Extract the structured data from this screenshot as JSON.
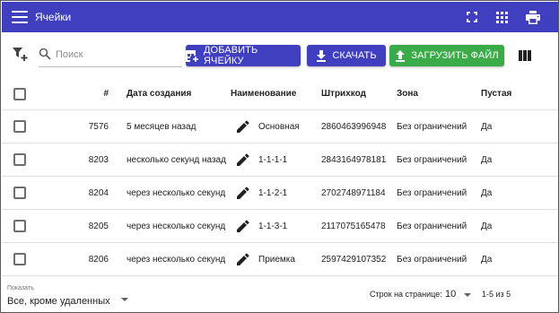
{
  "appbar": {
    "title": "Ячейки",
    "bg_color": "#3f3fbf",
    "icons": [
      "menu-icon",
      "fullscreen-icon",
      "apps-grid-icon",
      "print-icon"
    ]
  },
  "toolbar": {
    "search_placeholder": "Поиск",
    "add_label": "ДОБАВИТЬ ЯЧЕЙКУ",
    "download_label": "СКАЧАТЬ",
    "upload_label": "ЗАГРУЗИТЬ ФАЙЛ",
    "primary_color": "#3f3fbf",
    "upload_color": "#3aab48"
  },
  "table": {
    "headers": {
      "num": "#",
      "date": "Дата создания",
      "name": "Наименование",
      "barcode": "Штрихкод",
      "zone": "Зона",
      "empty": "Пустая"
    },
    "rows": [
      {
        "num": "7576",
        "date": "5 месяцев назад",
        "name": "Основная",
        "barcode": "2860463996948",
        "zone": "Без ограничений",
        "empty": "Да"
      },
      {
        "num": "8203",
        "date": "несколько секунд назад",
        "name": "1-1-1-1",
        "barcode": "2843164978181",
        "zone": "Без ограничений",
        "empty": "Да"
      },
      {
        "num": "8204",
        "date": "через несколько секунд",
        "name": "1-1-2-1",
        "barcode": "2702748971184",
        "zone": "Без ограничений",
        "empty": "Да"
      },
      {
        "num": "8205",
        "date": "через несколько секунд",
        "name": "1-1-3-1",
        "barcode": "2117075165478",
        "zone": "Без ограничений",
        "empty": "Да"
      },
      {
        "num": "8206",
        "date": "через несколько секунд",
        "name": "Приемка",
        "barcode": "2597429107352",
        "zone": "Без ограничений",
        "empty": "Да"
      }
    ]
  },
  "footer": {
    "show_label": "Показать",
    "show_value": "Все, кроме удаленных",
    "rows_per_page_label": "Строк на странице:",
    "rows_per_page_value": "10",
    "range_text": "1-5 из 5"
  }
}
